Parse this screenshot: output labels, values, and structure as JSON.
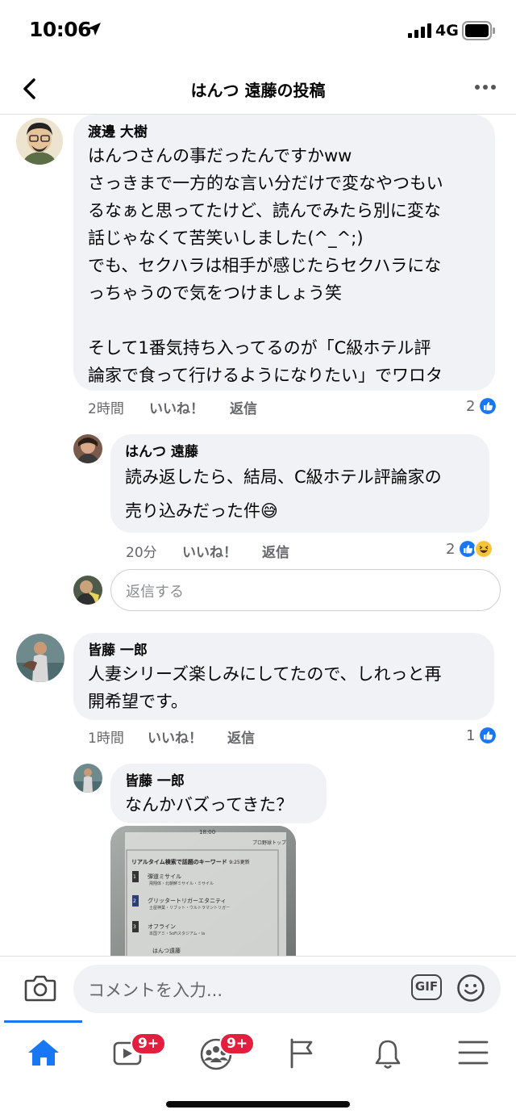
{
  "status_bar": {
    "time": "10:06",
    "network": "4G"
  },
  "header": {
    "title": "はんつ 遠藤の投稿"
  },
  "comments": [
    {
      "author": "渡邊 大樹",
      "lines": [
        "はんつさんの事だったんですかww",
        "さっきまで一方的な言い分だけで変なやつもい",
        "るなぁと思ってたけど、読んでみたら別に変な",
        "話じゃなくて苦笑いしました(^_^;)",
        "でも、セクハラは相手が感じたらセクハラにな",
        "っちゃうので気をつけましょう笑",
        "",
        "そして1番気持ち入ってるのが「C級ホテル評",
        "論家で食って行けるようになりたい」でワロタ"
      ],
      "time": "2時間",
      "like": "いいね！",
      "reply": "返信",
      "reactions": "2"
    },
    {
      "author": "はんつ 遠藤",
      "lines": [
        "読み返したら、結局、C級ホテル評論家の",
        "売り込みだった件😅"
      ],
      "time": "20分",
      "like": "いいね！",
      "reply": "返信",
      "reactions": "2"
    },
    {
      "author": "皆藤 一郎",
      "lines": [
        "人妻シリーズ楽しみにしてたので、しれっと再",
        "開希望です。"
      ],
      "time": "1時間",
      "like": "いいね！",
      "reply": "返信",
      "reactions": "1"
    },
    {
      "author": "皆藤 一郎",
      "lines": [
        "なんかバズってきた？"
      ]
    }
  ],
  "reply_box": {
    "placeholder": "返信する"
  },
  "photo": {
    "clock": "18:00",
    "top_right": "プロ野球トップ",
    "heading": "リアルタイム検索で話題のキーワード",
    "updated": "9:25更新",
    "items": [
      {
        "rank": "1",
        "title": "弾道ミサイル",
        "sub": "飛翔体・北朝鮮ミサイル・ミサイル"
      },
      {
        "rank": "2",
        "title": "グリッタートリガーエタニティ",
        "sub": "土屋神葉・リブット・ウルトラマントリガー"
      },
      {
        "rank": "3",
        "title": "オフライン",
        "sub": "本国アミ・SoFiスタジアム・la"
      },
      {
        "rank": "",
        "title": "はんつ遠藤",
        "sub": ""
      }
    ]
  },
  "composer": {
    "placeholder": "コメントを入力...",
    "gif": "GIF"
  },
  "tabs": {
    "watch_badge": "9+",
    "groups_badge": "9+"
  },
  "colors": {
    "accent": "#1877f2",
    "bubble": "#f0f2f5",
    "badge": "#e41e3f",
    "meta": "#65676b"
  }
}
